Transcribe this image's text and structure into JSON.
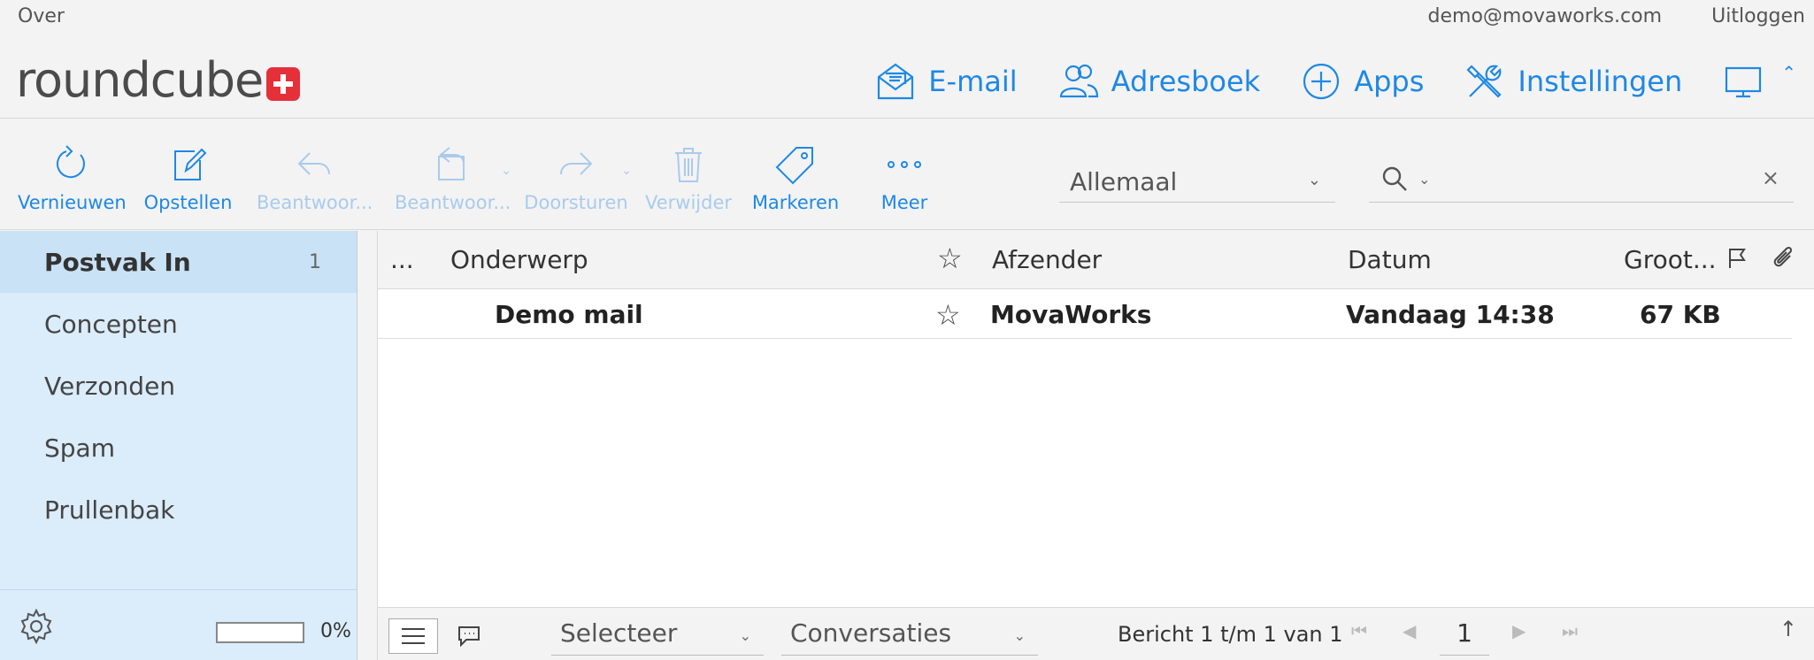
{
  "topbar": {
    "about": "Over",
    "user": "demo@movaworks.com",
    "logout": "Uitloggen"
  },
  "logo": {
    "text": "roundcube"
  },
  "taskbar": [
    {
      "label": "E-mail",
      "icon": "envelope-open-icon"
    },
    {
      "label": "Adresboek",
      "icon": "contacts-icon"
    },
    {
      "label": "Apps",
      "icon": "plus-circle-icon"
    },
    {
      "label": "Instellingen",
      "icon": "tools-icon"
    }
  ],
  "toolbar": {
    "refresh": "Vernieuwen",
    "compose": "Opstellen",
    "reply": "Beantwoor...",
    "reply_all": "Beantwoor...",
    "forward": "Doorsturen",
    "delete": "Verwijder",
    "mark": "Markeren",
    "more": "Meer"
  },
  "filter": {
    "value": "Allemaal"
  },
  "folders": [
    {
      "name": "Postvak In",
      "count": "1",
      "active": true
    },
    {
      "name": "Concepten",
      "count": ""
    },
    {
      "name": "Verzonden",
      "count": ""
    },
    {
      "name": "Spam",
      "count": ""
    },
    {
      "name": "Prullenbak",
      "count": ""
    }
  ],
  "quota": {
    "percent": 0,
    "label": "0%"
  },
  "table": {
    "headers": {
      "threads": "...",
      "subject": "Onderwerp",
      "sender": "Afzender",
      "date": "Datum",
      "size": "Groot..."
    },
    "rows": [
      {
        "subject": "Demo mail",
        "sender": "MovaWorks",
        "date": "Vandaag 14:38",
        "size": "67 KB"
      }
    ]
  },
  "listfooter": {
    "select": "Selecteer",
    "threads": "Conversaties",
    "count_text": "Bericht 1 t/m 1 van 1",
    "page": "1"
  },
  "colors": {
    "accent": "#1e88e5",
    "accent_disabled": "#a9cbec",
    "sidebar_bg": "#dbecfa",
    "logo_red": "#e5303a"
  }
}
